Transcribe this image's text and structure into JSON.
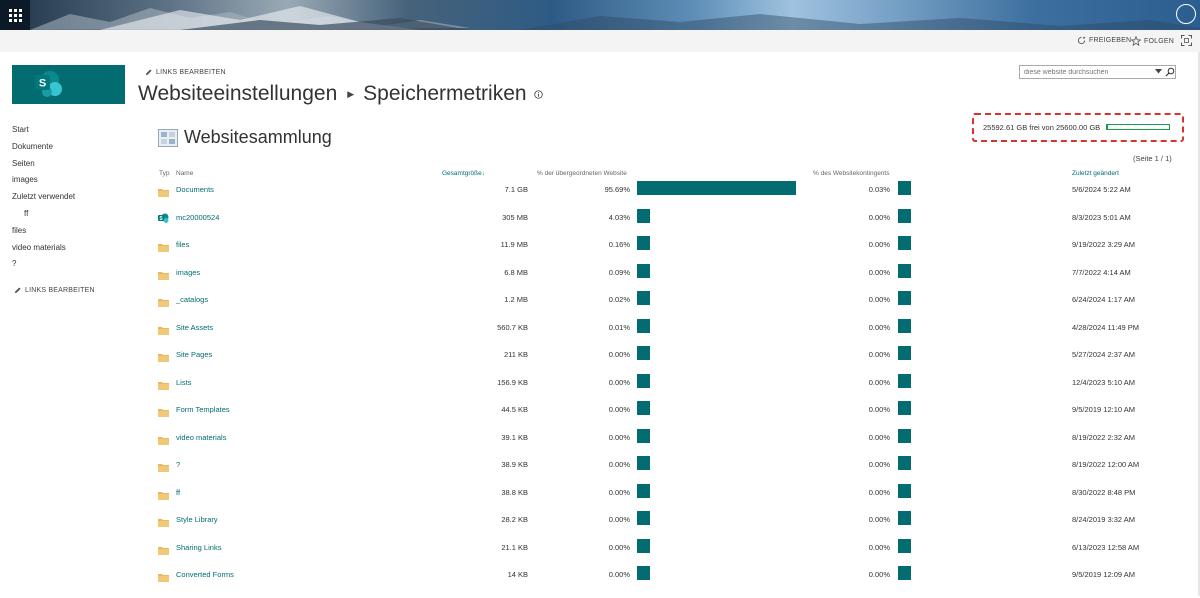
{
  "actions": {
    "share": "FREIGEBEN",
    "follow": "FOLGEN"
  },
  "edit_links": "LINKS BEARBEITEN",
  "title": {
    "part1": "Websiteeinstellungen",
    "part2": "Speichermetriken"
  },
  "search": {
    "placeholder": "diese website durchsuchen"
  },
  "nav": [
    {
      "label": "Start"
    },
    {
      "label": "Dokumente"
    },
    {
      "label": "Seiten"
    },
    {
      "label": "images"
    },
    {
      "label": "Zuletzt verwendet"
    },
    {
      "label": "ff",
      "sub": true
    },
    {
      "label": "files"
    },
    {
      "label": "video materials"
    },
    {
      "label": "?"
    }
  ],
  "section_title": "Websitesammlung",
  "quota": {
    "text": "25592.61 GB frei von 25600.00 GB",
    "used_fraction": 0.0003
  },
  "pager": "(Seite 1 / 1)",
  "columns": {
    "type": "Typ",
    "name": "Name",
    "total_size": "Gesamtgröße",
    "pct_parent": "% der übergeordneten Website",
    "pct_quota": "% des Websitekontingents",
    "modified": "Zuletzt geändert"
  },
  "rows": [
    {
      "icon": "folder-icon",
      "name": "Documents",
      "size": "7.1 GB",
      "pct_parent": "95.69%",
      "parent_value": 95.69,
      "pct_quota": "0.03%",
      "modified": "5/6/2024 5:22 AM"
    },
    {
      "icon": "sharepoint-site-icon",
      "name": "mc20000524",
      "size": "305 MB",
      "pct_parent": "4.03%",
      "parent_value": 4.03,
      "pct_quota": "0.00%",
      "modified": "8/3/2023 5:01 AM"
    },
    {
      "icon": "folder-icon",
      "name": "files",
      "size": "11.9 MB",
      "pct_parent": "0.16%",
      "parent_value": 0.16,
      "pct_quota": "0.00%",
      "modified": "9/19/2022 3:29 AM"
    },
    {
      "icon": "folder-icon",
      "name": "images",
      "size": "6.8 MB",
      "pct_parent": "0.09%",
      "parent_value": 0.09,
      "pct_quota": "0.00%",
      "modified": "7/7/2022 4:14 AM"
    },
    {
      "icon": "folder-icon",
      "name": "_catalogs",
      "size": "1.2 MB",
      "pct_parent": "0.02%",
      "parent_value": 0.02,
      "pct_quota": "0.00%",
      "modified": "6/24/2024 1:17 AM"
    },
    {
      "icon": "folder-icon",
      "name": "Site Assets",
      "size": "560.7 KB",
      "pct_parent": "0.01%",
      "parent_value": 0.01,
      "pct_quota": "0.00%",
      "modified": "4/28/2024 11:49 PM"
    },
    {
      "icon": "folder-icon",
      "name": "Site Pages",
      "size": "211 KB",
      "pct_parent": "0.00%",
      "parent_value": 0.0,
      "pct_quota": "0.00%",
      "modified": "5/27/2024 2:37 AM"
    },
    {
      "icon": "folder-icon",
      "name": "Lists",
      "size": "156.9 KB",
      "pct_parent": "0.00%",
      "parent_value": 0.0,
      "pct_quota": "0.00%",
      "modified": "12/4/2023 5:10 AM"
    },
    {
      "icon": "folder-icon",
      "name": "Form Templates",
      "size": "44.5 KB",
      "pct_parent": "0.00%",
      "parent_value": 0.0,
      "pct_quota": "0.00%",
      "modified": "9/5/2019 12:10 AM"
    },
    {
      "icon": "folder-icon",
      "name": "video materials",
      "size": "39.1 KB",
      "pct_parent": "0.00%",
      "parent_value": 0.0,
      "pct_quota": "0.00%",
      "modified": "8/19/2022 2:32 AM"
    },
    {
      "icon": "folder-icon",
      "name": "?",
      "size": "38.9 KB",
      "pct_parent": "0.00%",
      "parent_value": 0.0,
      "pct_quota": "0.00%",
      "modified": "8/19/2022 12:00 AM"
    },
    {
      "icon": "folder-icon",
      "name": "ff",
      "size": "38.8 KB",
      "pct_parent": "0.00%",
      "parent_value": 0.0,
      "pct_quota": "0.00%",
      "modified": "8/30/2022 8:48 PM"
    },
    {
      "icon": "folder-icon",
      "name": "Style Library",
      "size": "28.2 KB",
      "pct_parent": "0.00%",
      "parent_value": 0.0,
      "pct_quota": "0.00%",
      "modified": "8/24/2019 3:32 AM"
    },
    {
      "icon": "folder-icon",
      "name": "Sharing Links",
      "size": "21.1 KB",
      "pct_parent": "0.00%",
      "parent_value": 0.0,
      "pct_quota": "0.00%",
      "modified": "6/13/2023 12:58 AM"
    },
    {
      "icon": "folder-icon",
      "name": "Converted Forms",
      "size": "14 KB",
      "pct_parent": "0.00%",
      "parent_value": 0.0,
      "pct_quota": "0.00%",
      "modified": "9/5/2019 12:09 AM"
    }
  ],
  "colors": {
    "accent": "#036c70",
    "quota_bar": "#1a9c4f",
    "highlight_border": "#d9342b",
    "folder": "#e8b762"
  }
}
